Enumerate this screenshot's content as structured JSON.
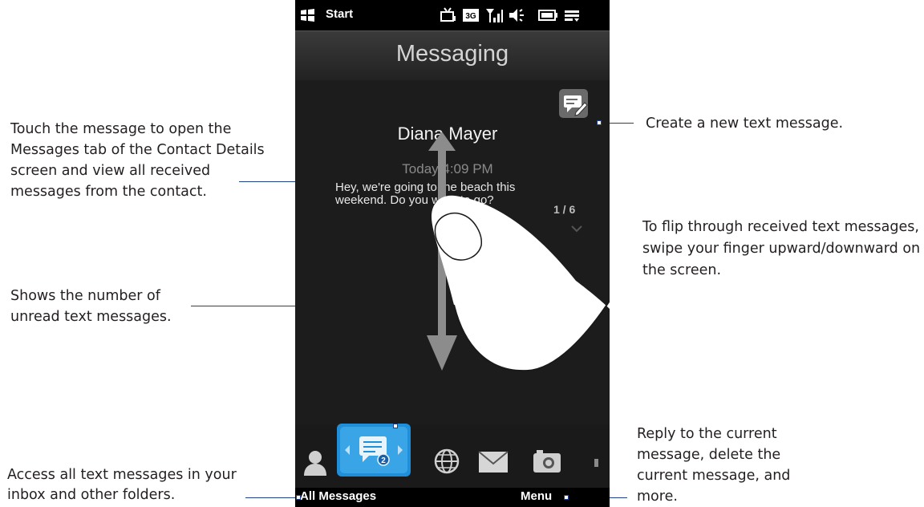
{
  "status_bar": {
    "start_label": "Start",
    "icons": [
      "tv-icon",
      "3g-icon",
      "signal-icon",
      "speaker-icon",
      "battery-icon",
      "list-icon"
    ]
  },
  "app": {
    "title": "Messaging",
    "contact_name": "Diana Mayer",
    "time": "Today 4:09 PM",
    "message": "Hey, we're going to the beach this weekend. Do you want to go?",
    "page_indicator": "1 / 6"
  },
  "tabs": [
    "contact-tab",
    "messaging-tab",
    "internet-tab",
    "email-tab",
    "photos-tab"
  ],
  "softkeys": {
    "left": "All Messages",
    "right": "Menu"
  },
  "callouts": {
    "touch_message": "Touch the message to open the Messages tab of the Contact Details screen and view all received messages from the contact.",
    "unread_count": "Shows the number of unread text messages.",
    "all_messages": "Access all text messages in your inbox and other folders.",
    "create_new": "Create a new text message.",
    "flip": "To flip through received text messages, swipe your finger upward/downward on the screen.",
    "menu": "Reply to the current message, delete the current message, and more."
  },
  "colors": {
    "callout_line": "#1f3f8a",
    "active_tab": "#1e8fd8",
    "phone_bg": "#1c1c1c"
  }
}
